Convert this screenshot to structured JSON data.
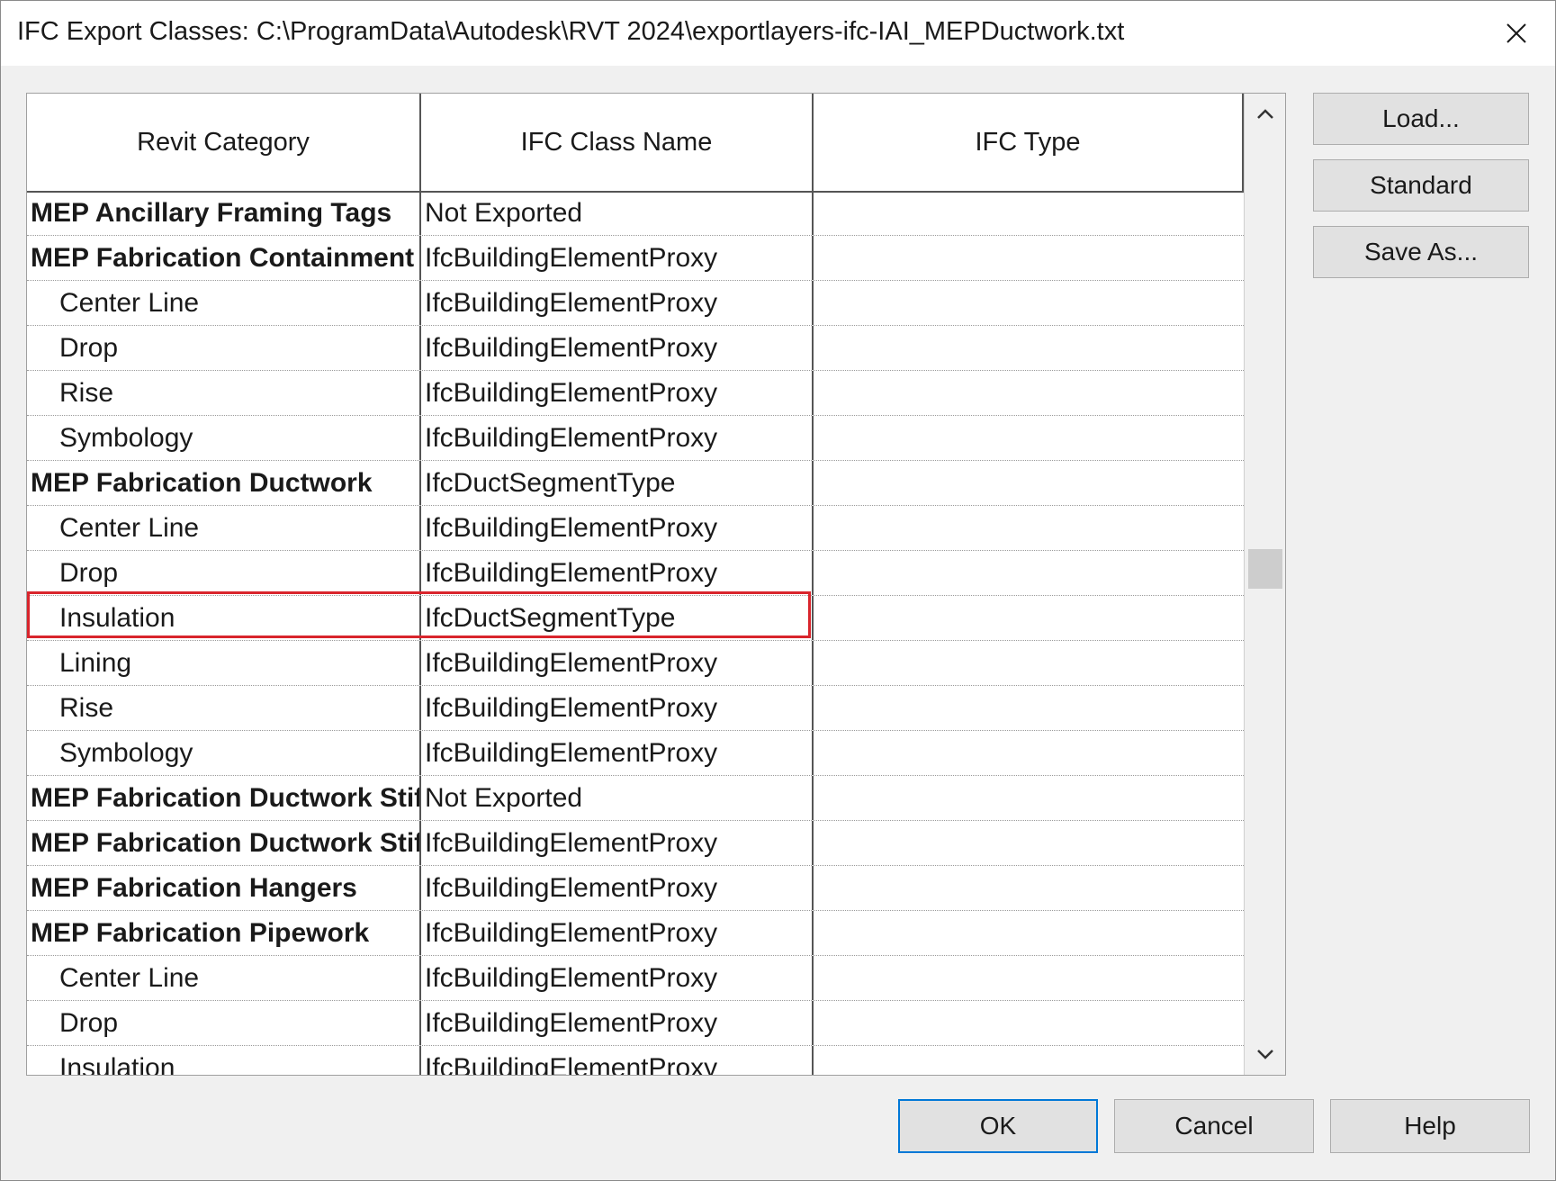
{
  "window": {
    "title": "IFC Export Classes: C:\\ProgramData\\Autodesk\\RVT 2024\\exportlayers-ifc-IAI_MEPDuctwork.txt"
  },
  "table": {
    "columns": [
      "Revit Category",
      "IFC Class Name",
      "IFC Type"
    ],
    "rows": [
      {
        "category": "MEP Ancillary Framing Tags",
        "ifc_class": "Not Exported",
        "ifc_type": "",
        "level": "parent"
      },
      {
        "category": "MEP Fabrication Containment",
        "ifc_class": "IfcBuildingElementProxy",
        "ifc_type": "",
        "level": "parent"
      },
      {
        "category": "Center Line",
        "ifc_class": "IfcBuildingElementProxy",
        "ifc_type": "",
        "level": "child"
      },
      {
        "category": "Drop",
        "ifc_class": "IfcBuildingElementProxy",
        "ifc_type": "",
        "level": "child"
      },
      {
        "category": "Rise",
        "ifc_class": "IfcBuildingElementProxy",
        "ifc_type": "",
        "level": "child"
      },
      {
        "category": "Symbology",
        "ifc_class": "IfcBuildingElementProxy",
        "ifc_type": "",
        "level": "child"
      },
      {
        "category": "MEP Fabrication Ductwork",
        "ifc_class": "IfcDuctSegmentType",
        "ifc_type": "",
        "level": "parent"
      },
      {
        "category": "Center Line",
        "ifc_class": "IfcBuildingElementProxy",
        "ifc_type": "",
        "level": "child"
      },
      {
        "category": "Drop",
        "ifc_class": "IfcBuildingElementProxy",
        "ifc_type": "",
        "level": "child"
      },
      {
        "category": "Insulation",
        "ifc_class": "IfcDuctSegmentType",
        "ifc_type": "",
        "level": "child",
        "highlighted": true
      },
      {
        "category": "Lining",
        "ifc_class": "IfcBuildingElementProxy",
        "ifc_type": "",
        "level": "child"
      },
      {
        "category": "Rise",
        "ifc_class": "IfcBuildingElementProxy",
        "ifc_type": "",
        "level": "child"
      },
      {
        "category": "Symbology",
        "ifc_class": "IfcBuildingElementProxy",
        "ifc_type": "",
        "level": "child"
      },
      {
        "category": "MEP Fabrication Ductwork Stif",
        "ifc_class": "Not Exported",
        "ifc_type": "",
        "level": "parent"
      },
      {
        "category": "MEP Fabrication Ductwork Stif",
        "ifc_class": "IfcBuildingElementProxy",
        "ifc_type": "",
        "level": "parent"
      },
      {
        "category": "MEP Fabrication Hangers",
        "ifc_class": "IfcBuildingElementProxy",
        "ifc_type": "",
        "level": "parent"
      },
      {
        "category": "MEP Fabrication Pipework",
        "ifc_class": "IfcBuildingElementProxy",
        "ifc_type": "",
        "level": "parent"
      },
      {
        "category": "Center Line",
        "ifc_class": "IfcBuildingElementProxy",
        "ifc_type": "",
        "level": "child"
      },
      {
        "category": "Drop",
        "ifc_class": "IfcBuildingElementProxy",
        "ifc_type": "",
        "level": "child"
      },
      {
        "category": "Insulation",
        "ifc_class": "IfcBuildingElementProxy",
        "ifc_type": "",
        "level": "child"
      }
    ]
  },
  "side_buttons": {
    "load": "Load...",
    "standard": "Standard",
    "save_as": "Save As..."
  },
  "footer_buttons": {
    "ok": "OK",
    "cancel": "Cancel",
    "help": "Help"
  },
  "icons": {
    "close": "close-icon",
    "scroll_up": "chevron-up-icon",
    "scroll_down": "chevron-down-icon"
  },
  "colors": {
    "highlight_border": "#d9252c",
    "default_button_border": "#0078d7"
  }
}
